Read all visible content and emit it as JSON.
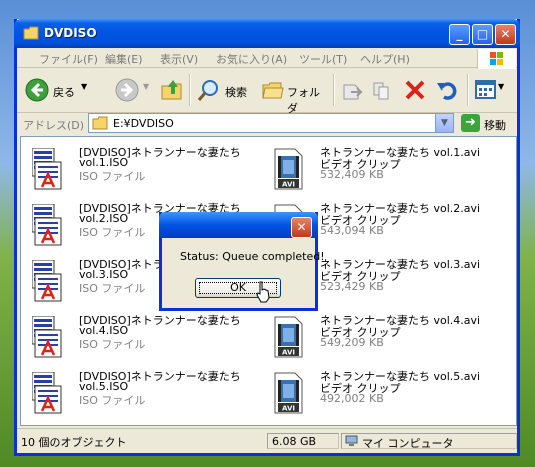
{
  "window": {
    "title": "DVDISO"
  },
  "menu": [
    "ファイル(F)",
    "編集(E)",
    "表示(V)",
    "お気に入り(A)",
    "ツール(T)",
    "ヘルプ(H)"
  ],
  "toolbar": {
    "back": "戻る",
    "search": "検索",
    "folders": "フォルダ"
  },
  "address": {
    "label": "アドレス(D)",
    "path": "E:¥DVDISO",
    "go": "移動"
  },
  "files": [
    {
      "name": "[DVDISO]ネトランナーな妻たち",
      "line2": "vol.1.ISO",
      "line3": "ISO ファイル",
      "kind": "iso"
    },
    {
      "name": "ネトランナーな妻たち vol.1.avi",
      "line2": "ビデオ クリップ",
      "line3": "532,409 KB",
      "kind": "avi"
    },
    {
      "name": "[DVDISO]ネトランナーな妻たち",
      "line2": "vol.2.ISO",
      "line3": "ISO ファイル",
      "kind": "iso"
    },
    {
      "name": "ネトランナーな妻たち vol.2.avi",
      "line2": "ビデオ クリップ",
      "line3": "543,094 KB",
      "kind": "avi"
    },
    {
      "name": "[DVDISO]ネトランナーな妻たち",
      "line2": "vol.3.ISO",
      "line3": "ISO ファイル",
      "kind": "iso"
    },
    {
      "name": "ネトランナーな妻たち vol.3.avi",
      "line2": "ビデオ クリップ",
      "line3": "523,429 KB",
      "kind": "avi"
    },
    {
      "name": "[DVDISO]ネトランナーな妻たち",
      "line2": "vol.4.ISO",
      "line3": "ISO ファイル",
      "kind": "iso"
    },
    {
      "name": "ネトランナーな妻たち vol.4.avi",
      "line2": "ビデオ クリップ",
      "line3": "549,209 KB",
      "kind": "avi"
    },
    {
      "name": "[DVDISO]ネトランナーな妻たち",
      "line2": "vol.5.ISO",
      "line3": "ISO ファイル",
      "kind": "iso"
    },
    {
      "name": "ネトランナーな妻たち vol.5.avi",
      "line2": "ビデオ クリップ",
      "line3": "492,002 KB",
      "kind": "avi"
    }
  ],
  "status": {
    "objects": "10 個のオブジェクト",
    "size": "6.08 GB",
    "location": "マイ コンピュータ"
  },
  "dialog": {
    "message": "Status: Queue completed!",
    "ok": "OK"
  },
  "colors": {
    "titlebar": "#0054e3",
    "face": "#ece9d8",
    "close": "#c1391c"
  }
}
